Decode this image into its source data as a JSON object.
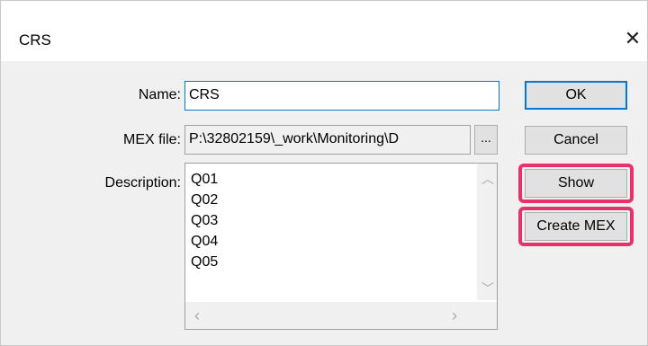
{
  "window": {
    "title": "CRS",
    "close_icon": "close-icon"
  },
  "form": {
    "name_label": "Name:",
    "name_value": "CRS",
    "mex_label": "MEX file:",
    "mex_value": "P:\\32802159\\_work\\Monitoring\\D",
    "browse_label": "...",
    "description_label": "Description:",
    "description_lines": [
      "Q01",
      "Q02",
      "Q03",
      "Q04",
      "Q05"
    ]
  },
  "buttons": {
    "ok": "OK",
    "cancel": "Cancel",
    "show": "Show",
    "create_mex": "Create MEX"
  },
  "highlight_color": "#e8306a",
  "accent_color": "#0078d7"
}
